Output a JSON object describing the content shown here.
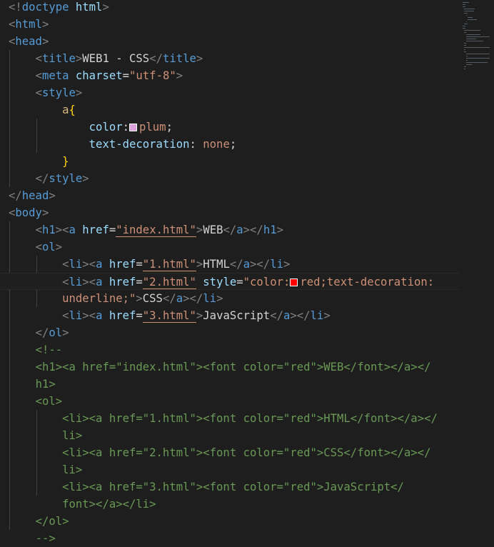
{
  "editor": {
    "swatch_colors": {
      "plum": "#dda0dd",
      "red": "#ff0000"
    },
    "lines": [
      [
        {
          "k": "p",
          "v": "<!"
        },
        {
          "k": "t",
          "v": "doctype"
        },
        {
          "k": "x",
          "v": " "
        },
        {
          "k": "a",
          "v": "html"
        },
        {
          "k": "p",
          "v": ">"
        }
      ],
      [
        {
          "k": "p",
          "v": "<"
        },
        {
          "k": "t",
          "v": "html"
        },
        {
          "k": "p",
          "v": ">"
        }
      ],
      [
        {
          "k": "p",
          "v": "<"
        },
        {
          "k": "t",
          "v": "head"
        },
        {
          "k": "p",
          "v": ">"
        }
      ],
      [
        {
          "k": "x",
          "v": "    "
        },
        {
          "k": "p",
          "v": "<"
        },
        {
          "k": "t",
          "v": "title"
        },
        {
          "k": "p",
          "v": ">"
        },
        {
          "k": "x",
          "v": "WEB1 - CSS"
        },
        {
          "k": "p",
          "v": "</"
        },
        {
          "k": "t",
          "v": "title"
        },
        {
          "k": "p",
          "v": ">"
        }
      ],
      [
        {
          "k": "x",
          "v": "    "
        },
        {
          "k": "p",
          "v": "<"
        },
        {
          "k": "t",
          "v": "meta"
        },
        {
          "k": "x",
          "v": " "
        },
        {
          "k": "a",
          "v": "charset"
        },
        {
          "k": "x",
          "v": "="
        },
        {
          "k": "s",
          "v": "\"utf-8\""
        },
        {
          "k": "p",
          "v": ">"
        }
      ],
      [
        {
          "k": "x",
          "v": "    "
        },
        {
          "k": "p",
          "v": "<"
        },
        {
          "k": "t",
          "v": "style"
        },
        {
          "k": "p",
          "v": ">"
        }
      ],
      [
        {
          "k": "x",
          "v": "        "
        },
        {
          "k": "y",
          "v": "a"
        },
        {
          "k": "b",
          "v": "{"
        }
      ],
      [
        {
          "k": "x",
          "v": "            "
        },
        {
          "k": "a",
          "v": "color"
        },
        {
          "k": "x",
          "v": ":"
        },
        {
          "k": "sw",
          "v": "plum"
        },
        {
          "k": "s",
          "v": "plum"
        },
        {
          "k": "x",
          "v": ";"
        }
      ],
      [
        {
          "k": "x",
          "v": "            "
        },
        {
          "k": "a",
          "v": "text-decoration"
        },
        {
          "k": "x",
          "v": ": "
        },
        {
          "k": "s",
          "v": "none"
        },
        {
          "k": "x",
          "v": ";"
        }
      ],
      [
        {
          "k": "x",
          "v": "        "
        },
        {
          "k": "b",
          "v": "}"
        }
      ],
      [
        {
          "k": "x",
          "v": "    "
        },
        {
          "k": "p",
          "v": "</"
        },
        {
          "k": "t",
          "v": "style"
        },
        {
          "k": "p",
          "v": ">"
        }
      ],
      [
        {
          "k": "p",
          "v": "</"
        },
        {
          "k": "t",
          "v": "head"
        },
        {
          "k": "p",
          "v": ">"
        }
      ],
      [
        {
          "k": "p",
          "v": "<"
        },
        {
          "k": "t",
          "v": "body"
        },
        {
          "k": "p",
          "v": ">"
        }
      ],
      [
        {
          "k": "x",
          "v": "    "
        },
        {
          "k": "p",
          "v": "<"
        },
        {
          "k": "t",
          "v": "h1"
        },
        {
          "k": "p",
          "v": "><"
        },
        {
          "k": "t",
          "v": "a"
        },
        {
          "k": "x",
          "v": " "
        },
        {
          "k": "a",
          "v": "href"
        },
        {
          "k": "x",
          "v": "="
        },
        {
          "k": "sl",
          "v": "\"index.html\""
        },
        {
          "k": "p",
          "v": ">"
        },
        {
          "k": "x",
          "v": "WEB"
        },
        {
          "k": "p",
          "v": "</"
        },
        {
          "k": "t",
          "v": "a"
        },
        {
          "k": "p",
          "v": "></"
        },
        {
          "k": "t",
          "v": "h1"
        },
        {
          "k": "p",
          "v": ">"
        }
      ],
      [
        {
          "k": "x",
          "v": "    "
        },
        {
          "k": "p",
          "v": "<"
        },
        {
          "k": "t",
          "v": "ol"
        },
        {
          "k": "p",
          "v": ">"
        }
      ],
      [
        {
          "k": "x",
          "v": "        "
        },
        {
          "k": "p",
          "v": "<"
        },
        {
          "k": "t",
          "v": "li"
        },
        {
          "k": "p",
          "v": "><"
        },
        {
          "k": "t",
          "v": "a"
        },
        {
          "k": "x",
          "v": " "
        },
        {
          "k": "a",
          "v": "href"
        },
        {
          "k": "x",
          "v": "="
        },
        {
          "k": "sl",
          "v": "\"1.html\""
        },
        {
          "k": "p",
          "v": ">"
        },
        {
          "k": "x",
          "v": "HTML"
        },
        {
          "k": "p",
          "v": "</"
        },
        {
          "k": "t",
          "v": "a"
        },
        {
          "k": "p",
          "v": "></"
        },
        {
          "k": "t",
          "v": "li"
        },
        {
          "k": "p",
          "v": ">"
        }
      ],
      [
        {
          "k": "x",
          "v": "        "
        },
        {
          "k": "p",
          "v": "<"
        },
        {
          "k": "t",
          "v": "li"
        },
        {
          "k": "p",
          "v": "><"
        },
        {
          "k": "t",
          "v": "a"
        },
        {
          "k": "x",
          "v": " "
        },
        {
          "k": "a",
          "v": "href"
        },
        {
          "k": "x",
          "v": "="
        },
        {
          "k": "sl",
          "v": "\"2.html\""
        },
        {
          "k": "x",
          "v": " "
        },
        {
          "k": "a",
          "v": "style"
        },
        {
          "k": "x",
          "v": "="
        },
        {
          "k": "s",
          "v": "\"color:"
        },
        {
          "k": "sw",
          "v": "red"
        },
        {
          "k": "s",
          "v": "red;text-decoration:"
        }
      ],
      [
        {
          "k": "x",
          "v": "        "
        },
        {
          "k": "s",
          "v": "underline;\""
        },
        {
          "k": "p",
          "v": ">"
        },
        {
          "k": "x",
          "v": "CSS"
        },
        {
          "k": "p",
          "v": "</"
        },
        {
          "k": "t",
          "v": "a"
        },
        {
          "k": "p",
          "v": "></"
        },
        {
          "k": "t",
          "v": "li"
        },
        {
          "k": "p",
          "v": ">"
        }
      ],
      [
        {
          "k": "x",
          "v": "        "
        },
        {
          "k": "p",
          "v": "<"
        },
        {
          "k": "t",
          "v": "li"
        },
        {
          "k": "p",
          "v": "><"
        },
        {
          "k": "t",
          "v": "a"
        },
        {
          "k": "x",
          "v": " "
        },
        {
          "k": "a",
          "v": "href"
        },
        {
          "k": "x",
          "v": "="
        },
        {
          "k": "sl",
          "v": "\"3.html\""
        },
        {
          "k": "p",
          "v": ">"
        },
        {
          "k": "x",
          "v": "JavaScript"
        },
        {
          "k": "p",
          "v": "</"
        },
        {
          "k": "t",
          "v": "a"
        },
        {
          "k": "p",
          "v": "></"
        },
        {
          "k": "t",
          "v": "li"
        },
        {
          "k": "p",
          "v": ">"
        }
      ],
      [
        {
          "k": "x",
          "v": "    "
        },
        {
          "k": "p",
          "v": "</"
        },
        {
          "k": "t",
          "v": "ol"
        },
        {
          "k": "p",
          "v": ">"
        }
      ],
      [
        {
          "k": "x",
          "v": "    "
        },
        {
          "k": "c",
          "v": "<!--"
        }
      ],
      [
        {
          "k": "x",
          "v": "    "
        },
        {
          "k": "c",
          "v": "<h1><a href=\"index.html\"><font color=\"red\">WEB</font></a></"
        }
      ],
      [
        {
          "k": "x",
          "v": "    "
        },
        {
          "k": "c",
          "v": "h1>"
        }
      ],
      [
        {
          "k": "x",
          "v": "    "
        },
        {
          "k": "c",
          "v": "<ol>"
        }
      ],
      [
        {
          "k": "x",
          "v": "        "
        },
        {
          "k": "c",
          "v": "<li><a href=\"1.html\"><font color=\"red\">HTML</font></a></"
        }
      ],
      [
        {
          "k": "x",
          "v": "        "
        },
        {
          "k": "c",
          "v": "li>"
        }
      ],
      [
        {
          "k": "x",
          "v": "        "
        },
        {
          "k": "c",
          "v": "<li><a href=\"2.html\"><font color=\"red\">CSS</font></a></"
        }
      ],
      [
        {
          "k": "x",
          "v": "        "
        },
        {
          "k": "c",
          "v": "li>"
        }
      ],
      [
        {
          "k": "x",
          "v": "        "
        },
        {
          "k": "c",
          "v": "<li><a href=\"3.html\"><font color=\"red\">JavaScript</"
        }
      ],
      [
        {
          "k": "x",
          "v": "        "
        },
        {
          "k": "c",
          "v": "font></a></li>"
        }
      ],
      [
        {
          "k": "x",
          "v": "    "
        },
        {
          "k": "c",
          "v": "</ol>"
        }
      ],
      [
        {
          "k": "x",
          "v": "    "
        },
        {
          "k": "c",
          "v": "-->"
        }
      ]
    ]
  }
}
